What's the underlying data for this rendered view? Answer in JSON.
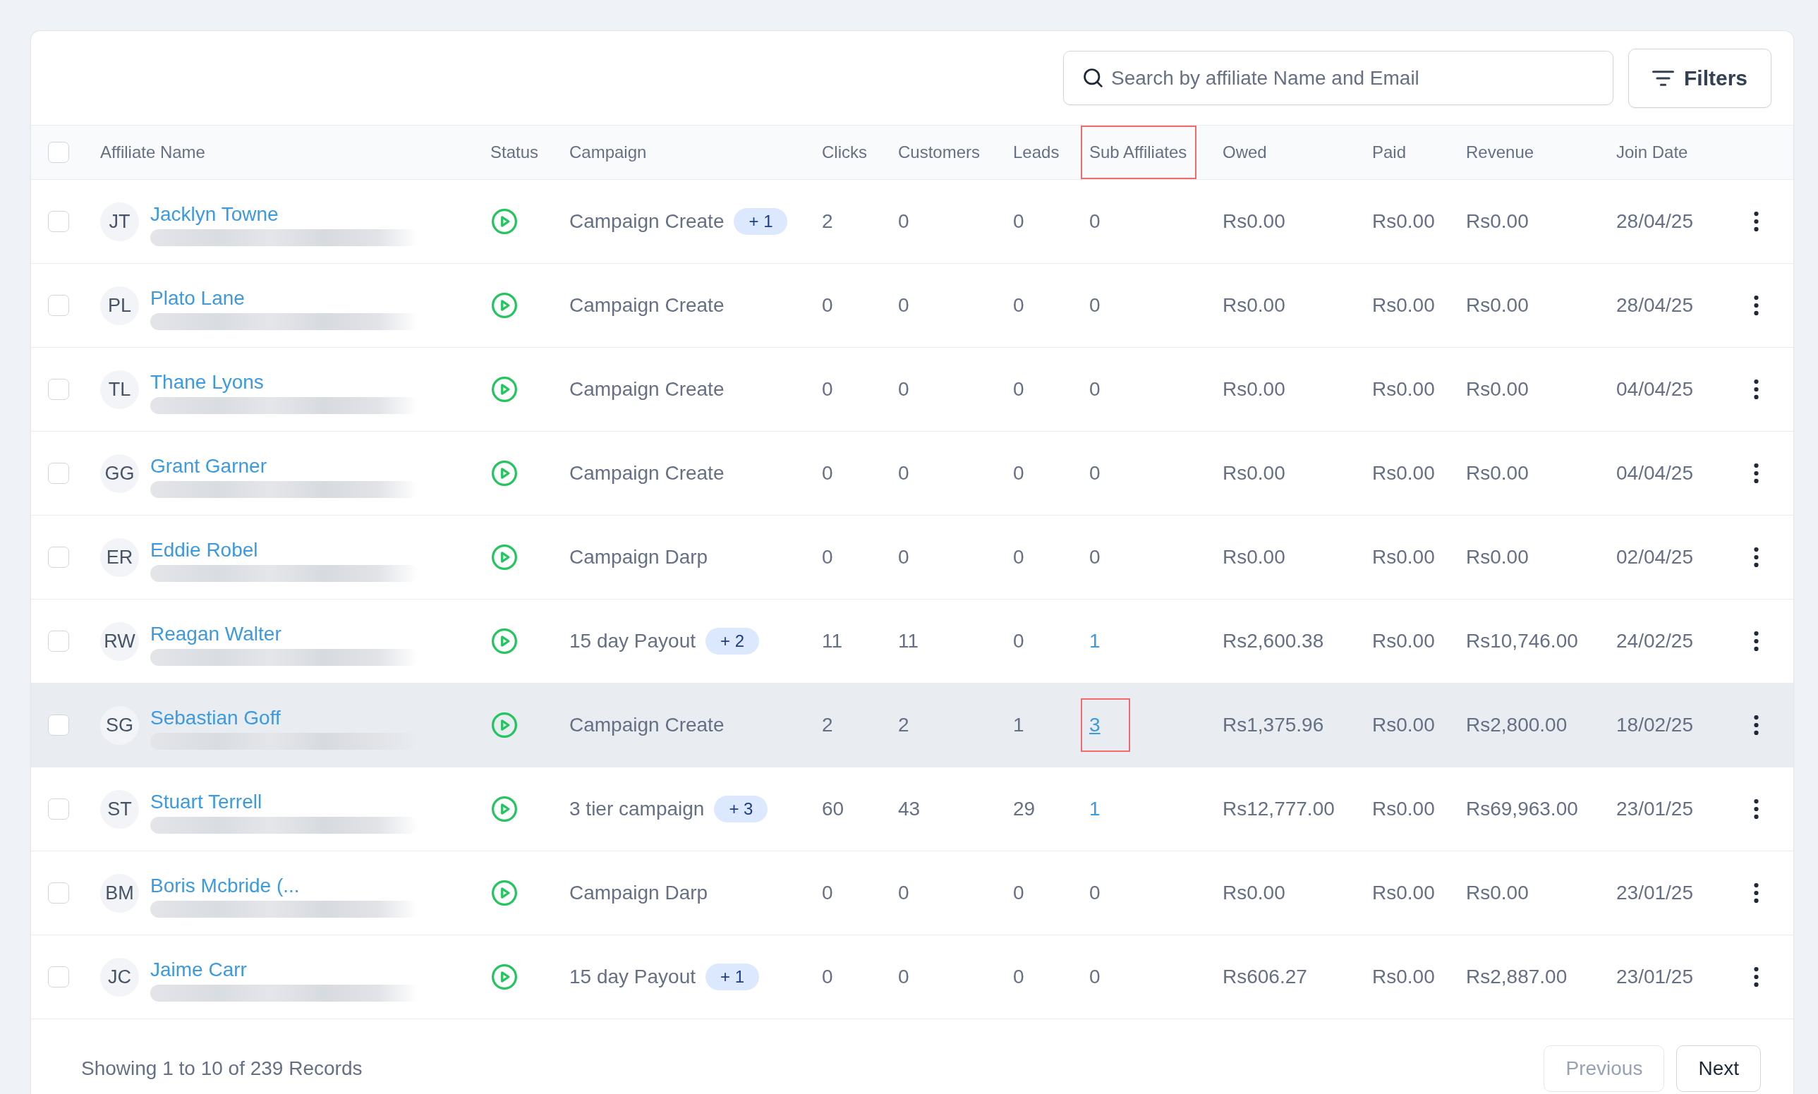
{
  "toolbar": {
    "search": {
      "placeholder": "Search by affiliate Name and Email"
    },
    "filters_button": "Filters"
  },
  "table": {
    "select_all": {
      "checked": false
    },
    "columns": [
      {
        "label": "Affiliate Name",
        "annotated": false
      },
      {
        "label": "Status",
        "annotated": false
      },
      {
        "label": "Campaign",
        "annotated": false
      },
      {
        "label": "Clicks",
        "annotated": false
      },
      {
        "label": "Customers",
        "annotated": false
      },
      {
        "label": "Leads",
        "annotated": false
      },
      {
        "label": "Sub Affiliates",
        "annotated": true
      },
      {
        "label": "Owed",
        "annotated": false
      },
      {
        "label": "Paid",
        "annotated": false
      },
      {
        "label": "Revenue",
        "annotated": false
      },
      {
        "label": "Join Date",
        "annotated": false
      }
    ],
    "rows": [
      {
        "checked": false,
        "highlighted": false,
        "initials": "JT",
        "name": "Jacklyn Towne",
        "email_redacted": true,
        "active": true,
        "campaign": "Campaign Create",
        "campaign_extra": "+ 1",
        "clicks": "2",
        "customers": "0",
        "leads": "0",
        "sub_affiliates": {
          "text": "0",
          "link": false,
          "underlined": false,
          "annotated": false
        },
        "owed": "Rs0.00",
        "paid": "Rs0.00",
        "revenue": "Rs0.00",
        "join_date": "28/04/25"
      },
      {
        "checked": false,
        "highlighted": false,
        "initials": "PL",
        "name": "Plato Lane",
        "email_redacted": true,
        "active": true,
        "campaign": "Campaign Create",
        "clicks": "0",
        "customers": "0",
        "leads": "0",
        "sub_affiliates": {
          "text": "0",
          "link": false,
          "underlined": false,
          "annotated": false
        },
        "owed": "Rs0.00",
        "paid": "Rs0.00",
        "revenue": "Rs0.00",
        "join_date": "28/04/25"
      },
      {
        "checked": false,
        "highlighted": false,
        "initials": "TL",
        "name": "Thane Lyons",
        "email_redacted": true,
        "active": true,
        "campaign": "Campaign Create",
        "clicks": "0",
        "customers": "0",
        "leads": "0",
        "sub_affiliates": {
          "text": "0",
          "link": false,
          "underlined": false,
          "annotated": false
        },
        "owed": "Rs0.00",
        "paid": "Rs0.00",
        "revenue": "Rs0.00",
        "join_date": "04/04/25"
      },
      {
        "checked": false,
        "highlighted": false,
        "initials": "GG",
        "name": "Grant Garner",
        "email_redacted": true,
        "active": true,
        "campaign": "Campaign Create",
        "clicks": "0",
        "customers": "0",
        "leads": "0",
        "sub_affiliates": {
          "text": "0",
          "link": false,
          "underlined": false,
          "annotated": false
        },
        "owed": "Rs0.00",
        "paid": "Rs0.00",
        "revenue": "Rs0.00",
        "join_date": "04/04/25"
      },
      {
        "checked": false,
        "highlighted": false,
        "initials": "ER",
        "name": "Eddie Robel",
        "email_redacted": true,
        "active": true,
        "campaign": "Campaign Darp",
        "clicks": "0",
        "customers": "0",
        "leads": "0",
        "sub_affiliates": {
          "text": "0",
          "link": false,
          "underlined": false,
          "annotated": false
        },
        "owed": "Rs0.00",
        "paid": "Rs0.00",
        "revenue": "Rs0.00",
        "join_date": "02/04/25"
      },
      {
        "checked": false,
        "highlighted": false,
        "initials": "RW",
        "name": "Reagan Walter",
        "email_redacted": true,
        "active": true,
        "campaign": "15 day Payout",
        "campaign_extra": "+ 2",
        "clicks": "11",
        "customers": "11",
        "leads": "0",
        "sub_affiliates": {
          "text": "1",
          "link": true,
          "underlined": false,
          "annotated": false
        },
        "owed": "Rs2,600.38",
        "paid": "Rs0.00",
        "revenue": "Rs10,746.00",
        "join_date": "24/02/25"
      },
      {
        "checked": false,
        "highlighted": true,
        "initials": "SG",
        "name": "Sebastian Goff",
        "email_redacted": true,
        "active": true,
        "campaign": "Campaign Create",
        "clicks": "2",
        "customers": "2",
        "leads": "1",
        "sub_affiliates": {
          "text": "3",
          "link": true,
          "underlined": true,
          "annotated": true
        },
        "owed": "Rs1,375.96",
        "paid": "Rs0.00",
        "revenue": "Rs2,800.00",
        "join_date": "18/02/25"
      },
      {
        "checked": false,
        "highlighted": false,
        "initials": "ST",
        "name": "Stuart Terrell",
        "email_redacted": true,
        "active": true,
        "campaign": "3 tier campaign",
        "campaign_extra": "+ 3",
        "clicks": "60",
        "customers": "43",
        "leads": "29",
        "sub_affiliates": {
          "text": "1",
          "link": true,
          "underlined": false,
          "annotated": false
        },
        "owed": "Rs12,777.00",
        "paid": "Rs0.00",
        "revenue": "Rs69,963.00",
        "join_date": "23/01/25"
      },
      {
        "checked": false,
        "highlighted": false,
        "initials": "BM",
        "name": "Boris Mcbride (...",
        "email_redacted": true,
        "active": true,
        "campaign": "Campaign Darp",
        "clicks": "0",
        "customers": "0",
        "leads": "0",
        "sub_affiliates": {
          "text": "0",
          "link": false,
          "underlined": false,
          "annotated": false
        },
        "owed": "Rs0.00",
        "paid": "Rs0.00",
        "revenue": "Rs0.00",
        "join_date": "23/01/25"
      },
      {
        "checked": false,
        "highlighted": false,
        "initials": "JC",
        "name": "Jaime Carr",
        "email_redacted": true,
        "active": true,
        "campaign": "15 day Payout",
        "campaign_extra": "+ 1",
        "clicks": "0",
        "customers": "0",
        "leads": "0",
        "sub_affiliates": {
          "text": "0",
          "link": false,
          "underlined": false,
          "annotated": false
        },
        "owed": "Rs606.27",
        "paid": "Rs0.00",
        "revenue": "Rs2,887.00",
        "join_date": "23/01/25"
      }
    ]
  },
  "footer": {
    "summary": "Showing 1 to 10 of 239 Records",
    "buttons": [
      {
        "label": "Previous",
        "disabled": true
      },
      {
        "label": "Next",
        "disabled": false
      }
    ]
  }
}
